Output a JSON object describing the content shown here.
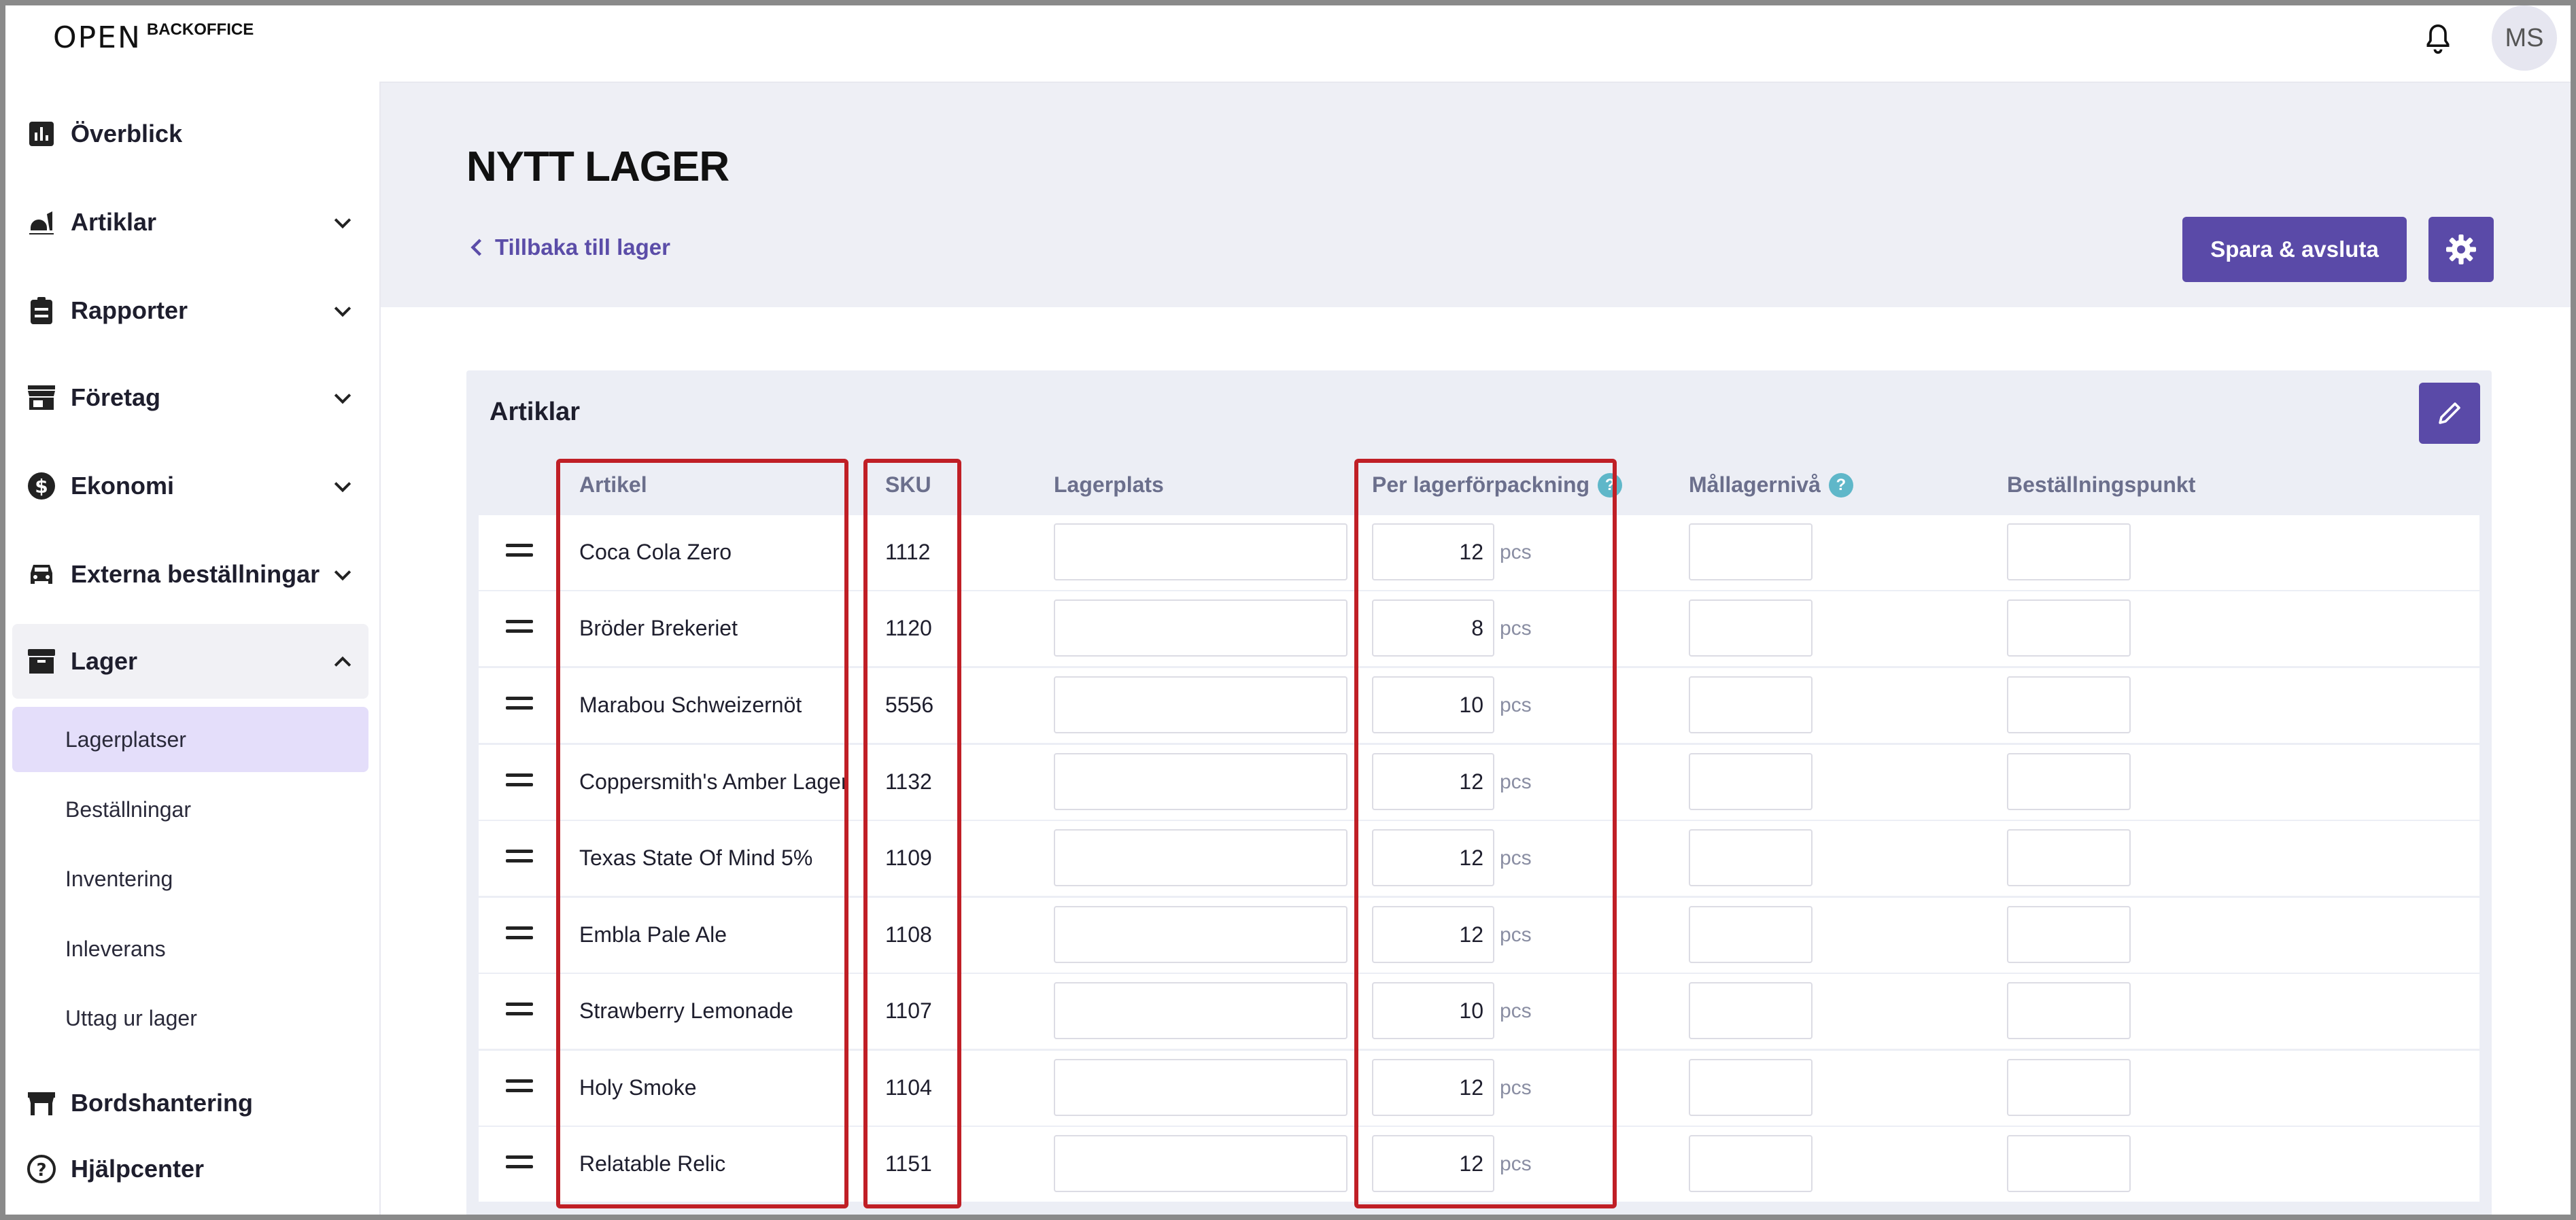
{
  "app": {
    "logo_mark": "OPEN",
    "logo_text": "BACKOFFICE",
    "user_initials": "MS"
  },
  "sidebar": {
    "items": [
      {
        "label": "Överblick",
        "icon": "chart-icon"
      },
      {
        "label": "Artiklar",
        "icon": "food-icon"
      },
      {
        "label": "Rapporter",
        "icon": "clipboard-icon"
      },
      {
        "label": "Företag",
        "icon": "store-icon"
      },
      {
        "label": "Ekonomi",
        "icon": "dollar-icon"
      },
      {
        "label": "Externa beställningar",
        "icon": "car-icon"
      },
      {
        "label": "Lager",
        "icon": "archive-icon"
      }
    ],
    "sub_items": [
      "Lagerplatser",
      "Beställningar",
      "Inventering",
      "Inleverans",
      "Uttag ur lager"
    ],
    "bottom_items": [
      {
        "label": "Bordshantering",
        "icon": "table-icon"
      },
      {
        "label": "Hjälpcenter",
        "icon": "help-circle-icon"
      }
    ]
  },
  "page": {
    "title": "NYTT LAGER",
    "back_label": "Tillbaka till lager",
    "save_label": "Spara & avsluta"
  },
  "card": {
    "title": "Artiklar",
    "columns": [
      "Artikel",
      "SKU",
      "Lagerplats",
      "Per lagerförpackning",
      "Mållagernivå",
      "Beställningspunkt"
    ],
    "unit": "pcs",
    "rows": [
      {
        "name": "Coca Cola Zero",
        "sku": "1112",
        "per_pack": "12"
      },
      {
        "name": "Bröder Brekeriet",
        "sku": "1120",
        "per_pack": "8"
      },
      {
        "name": "Marabou Schweizernöt",
        "sku": "5556",
        "per_pack": "10"
      },
      {
        "name": "Coppersmith's Amber Lager",
        "sku": "1132",
        "per_pack": "12"
      },
      {
        "name": "Texas State Of Mind 5%",
        "sku": "1109",
        "per_pack": "12"
      },
      {
        "name": "Embla Pale Ale",
        "sku": "1108",
        "per_pack": "12"
      },
      {
        "name": "Strawberry Lemonade",
        "sku": "1107",
        "per_pack": "10"
      },
      {
        "name": "Holy Smoke",
        "sku": "1104",
        "per_pack": "12"
      },
      {
        "name": "Relatable Relic",
        "sku": "1151",
        "per_pack": "12"
      }
    ]
  },
  "colors": {
    "accent": "#5a4aa8",
    "highlight": "#c01f26",
    "active_bg": "#e4defa"
  }
}
